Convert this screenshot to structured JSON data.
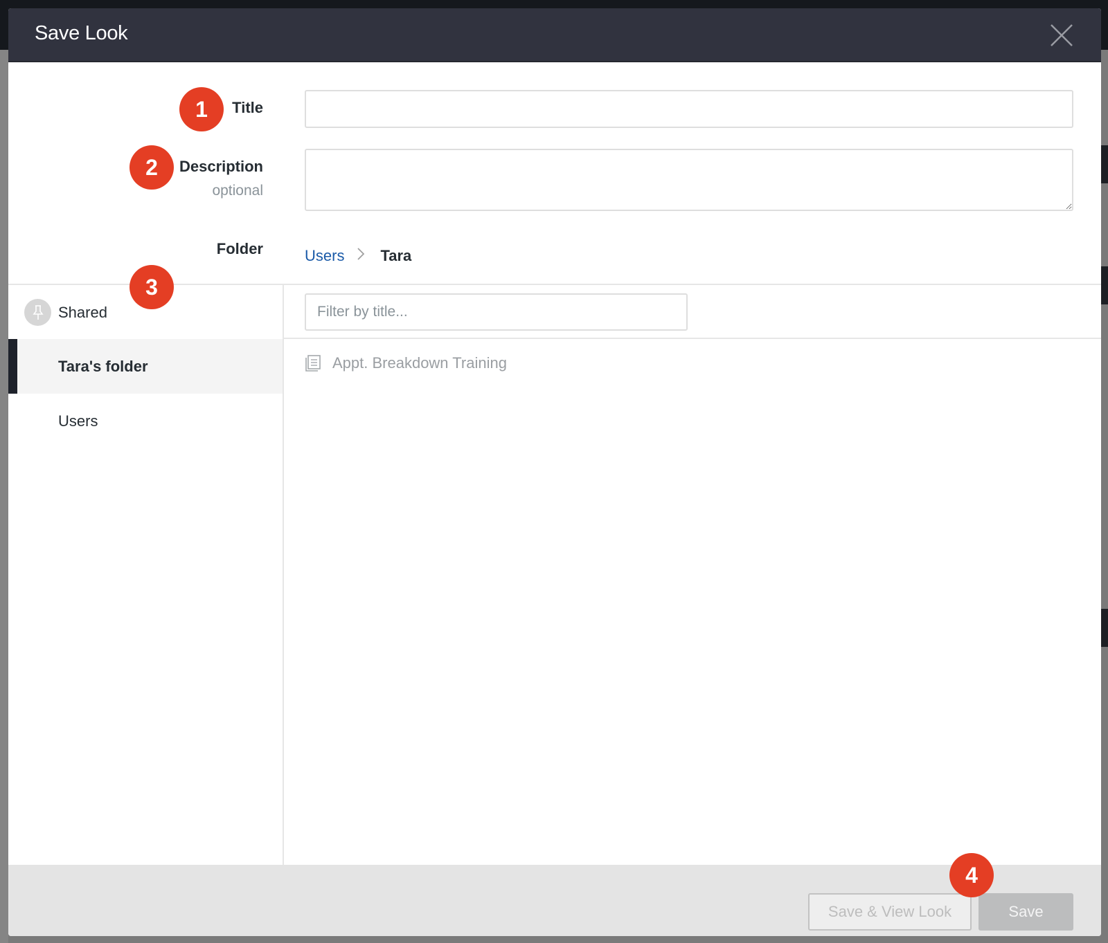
{
  "dialog": {
    "title": "Save Look",
    "close_label": "close"
  },
  "form": {
    "title_label": "Title",
    "title_value": "",
    "title_placeholder": "",
    "description_label": "Description",
    "description_hint": "optional",
    "description_value": "",
    "folder_label": "Folder",
    "folder_path": [
      {
        "label": "Users",
        "link": true
      },
      {
        "label": "Tara",
        "link": false
      }
    ],
    "breadcrumb_separator": ">"
  },
  "sidebar": {
    "items": [
      {
        "label": "Shared",
        "icon": "pin-icon",
        "selected": false
      },
      {
        "label": "Tara's folder",
        "selected": true
      },
      {
        "label": "Users",
        "selected": false
      }
    ]
  },
  "content": {
    "filter_placeholder": "Filter by title...",
    "filter_value": "",
    "items": [
      {
        "label": "Appt. Breakdown Training",
        "icon": "look-document-icon"
      }
    ]
  },
  "footer": {
    "save_and_view_label": "Save & View Look",
    "save_label": "Save"
  },
  "annotations": {
    "badges": [
      "1",
      "2",
      "3",
      "4"
    ],
    "color": "#e43e24"
  },
  "colors": {
    "header_bg": "#31333f",
    "link": "#1a5aa8",
    "selected_bar": "#1e222b"
  }
}
